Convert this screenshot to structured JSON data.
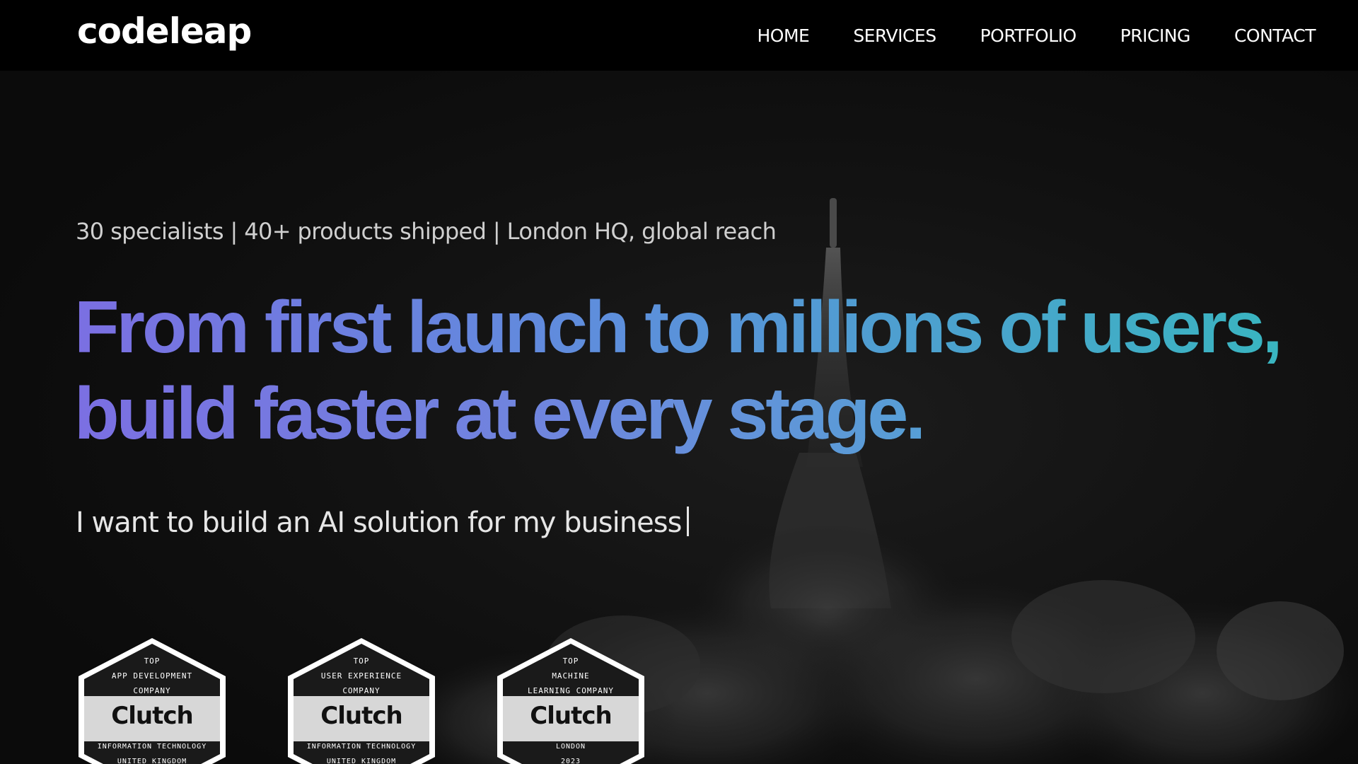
{
  "brand": {
    "logo_text": "codeleap"
  },
  "nav": {
    "items": [
      {
        "label": "HOME"
      },
      {
        "label": "SERVICES"
      },
      {
        "label": "PORTFOLIO"
      },
      {
        "label": "PRICING"
      },
      {
        "label": "CONTACT"
      }
    ]
  },
  "hero": {
    "stats_line": "30 specialists | 40+ products shipped | London HQ, global reach",
    "headline_line1": "From first launch to millions of users,",
    "headline_line2": "build faster at every stage.",
    "typing_text": "I want to build an AI solution for my business"
  },
  "badges": [
    {
      "top_line1": "TOP",
      "top_line2": "APP DEVELOPMENT",
      "top_line3": "COMPANY",
      "brand": "Clutch",
      "bottom_line1": "INFORMATION TECHNOLOGY",
      "bottom_line2": "UNITED KINGDOM"
    },
    {
      "top_line1": "TOP",
      "top_line2": "USER EXPERIENCE",
      "top_line3": "COMPANY",
      "brand": "Clutch",
      "bottom_line1": "INFORMATION TECHNOLOGY",
      "bottom_line2": "UNITED KINGDOM"
    },
    {
      "top_line1": "TOP",
      "top_line2": "MACHINE",
      "top_line3": "LEARNING COMPANY",
      "brand": "Clutch",
      "bottom_line1": "LONDON",
      "bottom_line2": "2023"
    }
  ],
  "colors": {
    "nav_background": "#000000",
    "headline_gradient_start": "#7b6fe2",
    "headline_gradient_end": "#39b5c0",
    "page_background": "#0b0b0b"
  },
  "icons": {
    "hero_background": "rocket-launch-image"
  }
}
